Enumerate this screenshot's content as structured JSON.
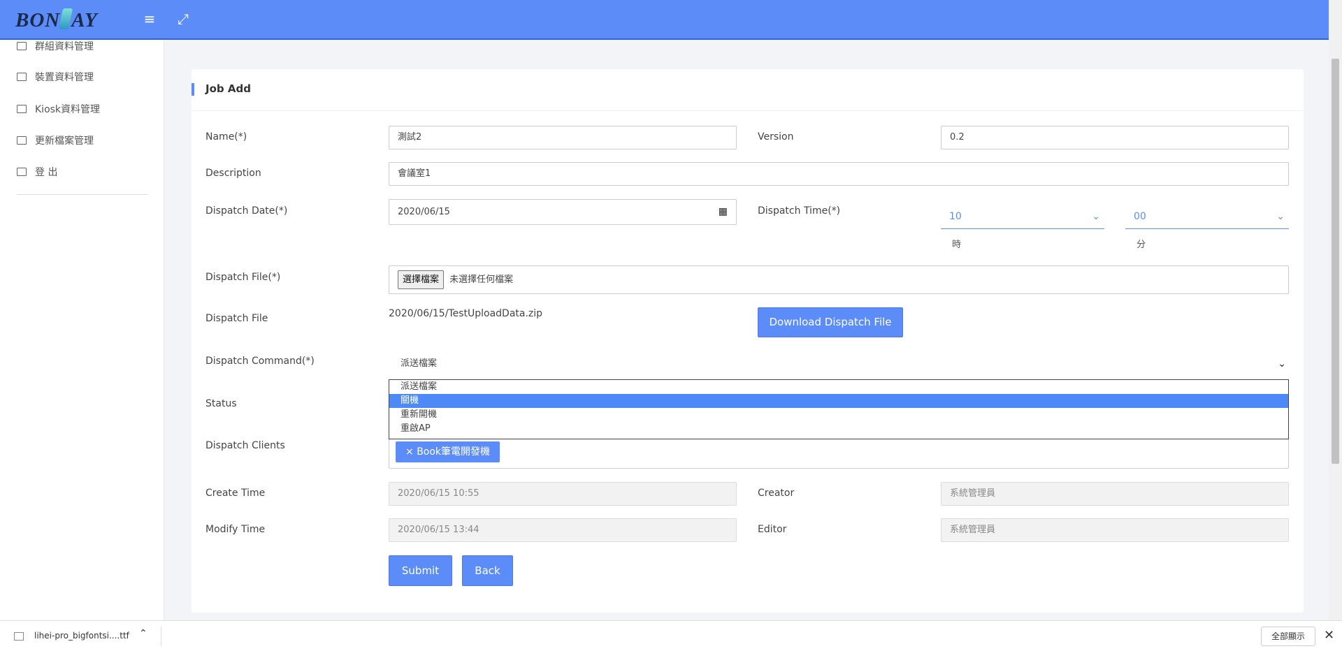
{
  "brand": {
    "logo_left": "BON",
    "logo_right": "AY"
  },
  "topbar": {
    "menu_icon": "menu-icon",
    "expand_icon": "fullscreen-icon"
  },
  "sidebar": {
    "items": [
      {
        "label": "群組資料管理",
        "icon": "list-icon"
      },
      {
        "label": "裝置資料管理",
        "icon": "list-icon"
      },
      {
        "label": "Kiosk資料管理",
        "icon": "database-icon"
      },
      {
        "label": "更新檔案管理",
        "icon": "copy-icon"
      },
      {
        "label": "登 出",
        "icon": "logout-icon"
      }
    ]
  },
  "form": {
    "title": "Job Add",
    "name_label": "Name(*)",
    "name_value": "測試2",
    "version_label": "Version",
    "version_value": "0.2",
    "description_label": "Description",
    "description_value": "會議室1",
    "dispatch_date_label": "Dispatch Date(*)",
    "dispatch_date_value": "2020/06/15",
    "dispatch_time_label": "Dispatch Time(*)",
    "hour_value": "10",
    "hour_hint": "時",
    "minute_value": "00",
    "minute_hint": "分",
    "dispatch_file_input_label": "Dispatch File(*)",
    "choose_file_button": "選擇檔案",
    "no_file_text": "未選擇任何檔案",
    "dispatch_file_label": "Dispatch File",
    "dispatch_file_value": "2020/06/15/TestUploadData.zip",
    "download_button": "Download Dispatch File",
    "dispatch_command_label": "Dispatch Command(*)",
    "dispatch_command_value": "派送檔案",
    "command_options": [
      "派送檔案",
      "關機",
      "重新開機",
      "重啟AP"
    ],
    "command_highlighted_index": 1,
    "status_label": "Status",
    "dispatch_clients_label": "Dispatch Clients",
    "client_tag": "Book筆電開發機",
    "create_time_label": "Create Time",
    "create_time_value": "2020/06/15 10:55",
    "creator_label": "Creator",
    "creator_value": "系統管理員",
    "modify_time_label": "Modify Time",
    "modify_time_value": "2020/06/15 13:44",
    "editor_label": "Editor",
    "editor_value": "系統管理員",
    "submit_button": "Submit",
    "back_button": "Back"
  },
  "download_bar": {
    "file_name": "lihei-pro_bigfontsi....ttf",
    "show_all_button": "全部顯示"
  },
  "colors": {
    "primary": "#5b8cf8",
    "highlight": "#4d8af7"
  }
}
